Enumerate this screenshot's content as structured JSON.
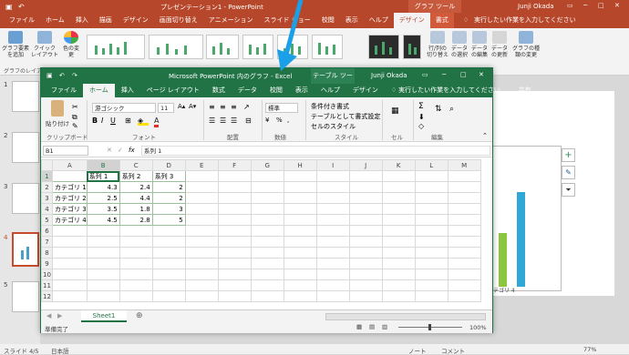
{
  "ppt": {
    "title": "プレゼンテーション1 - PowerPoint",
    "context_title": "グラフ ツール",
    "user": "Junji Okada",
    "tabs": [
      "ファイル",
      "ホーム",
      "挿入",
      "描画",
      "デザイン",
      "画面切り替え",
      "アニメーション",
      "スライド ショー",
      "校閲",
      "表示",
      "ヘルプ",
      "デザイン",
      "書式"
    ],
    "tell_me": "実行したい作業を入力してください",
    "ribbon": {
      "add_element": "グラフ要素を追加",
      "quick_layout": "クイック レイアウト",
      "change_color": "色の変更",
      "layout_group": "グラフのレイアウト",
      "switch_row_col": "行/列の切り替え",
      "select_data": "データの選択",
      "edit_data": "データの編集",
      "refresh_data": "データの更新",
      "change_type": "グラフの種類の変更"
    },
    "slide_numbers": [
      "1",
      "2",
      "3",
      "4",
      "5"
    ],
    "chart_category_label": "カテゴリ 4",
    "status": {
      "slide": "スライド 4/5",
      "lang": "日本語",
      "notes": "ノート",
      "comments": "コメント",
      "zoom": "77%"
    },
    "colors": {
      "ppt": "#b7472a",
      "excel": "#217346",
      "arrow": "#1aa0e8"
    }
  },
  "excel": {
    "title": "Microsoft PowerPoint 内のグラフ - Excel",
    "context_title": "テーブル ツール",
    "user": "Junji Okada",
    "share": "共有",
    "tabs": [
      "ファイル",
      "ホーム",
      "挿入",
      "ページ レイアウト",
      "数式",
      "データ",
      "校閲",
      "表示",
      "ヘルプ",
      "デザイン"
    ],
    "tell_me": "実行したい作業を入力してください",
    "ribbon": {
      "paste": "貼り付け",
      "clipboard": "クリップボード",
      "font_name": "游ゴシック",
      "font_size": "11",
      "font_group": "フォント",
      "align_group": "配置",
      "number_format": "標準",
      "number_group": "数値",
      "cond_format": "条件付き書式",
      "table_format": "テーブルとして書式設定",
      "cell_style": "セルのスタイル",
      "style_group": "スタイル",
      "cells_group": "セル",
      "edit_group": "編集"
    },
    "name_box": "B1",
    "fx": "fx",
    "formula": "系列 1",
    "columns": [
      "A",
      "B",
      "C",
      "D",
      "E",
      "F",
      "G",
      "H",
      "I",
      "J",
      "K",
      "L",
      "M"
    ],
    "rows": [
      [
        "",
        "系列 1",
        "系列 2",
        "系列 3"
      ],
      [
        "カテゴリ 1",
        "4.3",
        "2.4",
        "2"
      ],
      [
        "カテゴリ 2",
        "2.5",
        "4.4",
        "2"
      ],
      [
        "カテゴリ 3",
        "3.5",
        "1.8",
        "3"
      ],
      [
        "カテゴリ 4",
        "4.5",
        "2.8",
        "5"
      ],
      [
        "",
        "",
        "",
        ""
      ],
      [
        "",
        "",
        "",
        ""
      ],
      [
        "",
        "",
        "",
        ""
      ],
      [
        "",
        "",
        "",
        ""
      ],
      [
        "",
        "",
        "",
        ""
      ],
      [
        "",
        "",
        "",
        ""
      ],
      [
        "",
        "",
        "",
        ""
      ]
    ],
    "sheet_tab": "Sheet1",
    "status": "準備完了",
    "zoom": "100%"
  }
}
